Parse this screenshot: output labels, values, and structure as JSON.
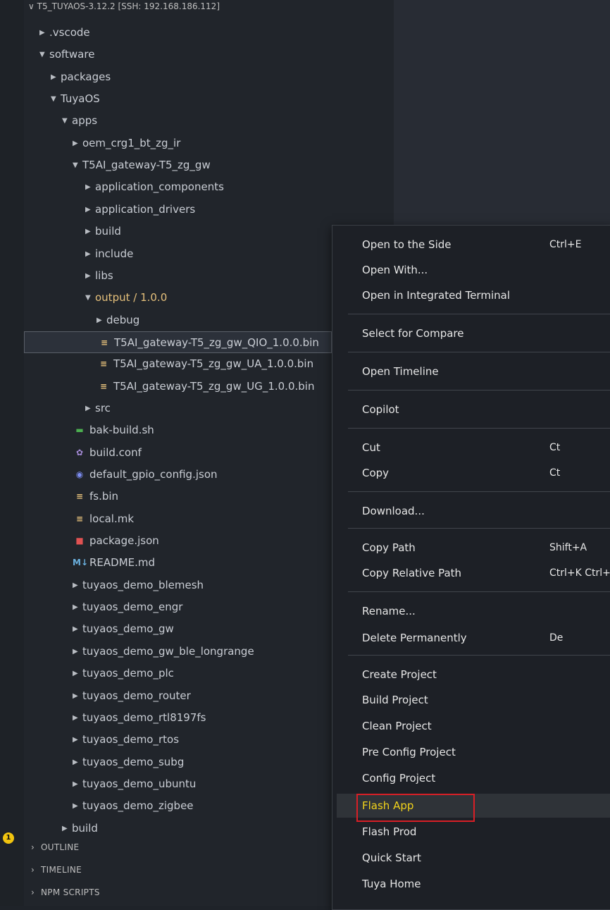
{
  "explorer": {
    "root_label": "T5_TUYAOS-3.12.2 [SSH: 192.168.186.112]",
    "tree": [
      {
        "label": ".vscode",
        "indent": 0,
        "kind": "folder",
        "open": false
      },
      {
        "label": "software",
        "indent": 0,
        "kind": "folder",
        "open": true
      },
      {
        "label": "packages",
        "indent": 1,
        "kind": "folder",
        "open": false
      },
      {
        "label": "TuyaOS",
        "indent": 1,
        "kind": "folder",
        "open": true
      },
      {
        "label": "apps",
        "indent": 2,
        "kind": "folder",
        "open": true
      },
      {
        "label": "oem_crg1_bt_zg_ir",
        "indent": 3,
        "kind": "folder",
        "open": false
      },
      {
        "label": "T5AI_gateway-T5_zg_gw",
        "indent": 3,
        "kind": "folder",
        "open": true
      },
      {
        "label": "application_components",
        "indent": 4,
        "kind": "folder",
        "open": false
      },
      {
        "label": "application_drivers",
        "indent": 4,
        "kind": "folder",
        "open": false
      },
      {
        "label": "build",
        "indent": 4,
        "kind": "folder",
        "open": false
      },
      {
        "label": "include",
        "indent": 4,
        "kind": "folder",
        "open": false
      },
      {
        "label": "libs",
        "indent": 4,
        "kind": "folder",
        "open": false
      },
      {
        "label": "output / 1.0.0",
        "indent": 4,
        "kind": "folder",
        "open": true,
        "highlight": true
      },
      {
        "label": "debug",
        "indent": 5,
        "kind": "folder",
        "open": false
      },
      {
        "label": "T5AI_gateway-T5_zg_gw_QIO_1.0.0.bin",
        "indent": 5,
        "kind": "file",
        "icon": "≡",
        "icon_color": "#e5c07b",
        "selected": true
      },
      {
        "label": "T5AI_gateway-T5_zg_gw_UA_1.0.0.bin",
        "indent": 5,
        "kind": "file",
        "icon": "≡",
        "icon_color": "#e5c07b"
      },
      {
        "label": "T5AI_gateway-T5_zg_gw_UG_1.0.0.bin",
        "indent": 5,
        "kind": "file",
        "icon": "≡",
        "icon_color": "#e5c07b"
      },
      {
        "label": "src",
        "indent": 4,
        "kind": "folder",
        "open": false
      },
      {
        "label": "bak-build.sh",
        "indent": 3,
        "kind": "file",
        "icon": "▬",
        "icon_color": "#4caf50"
      },
      {
        "label": "build.conf",
        "indent": 3,
        "kind": "file",
        "icon": "✿",
        "icon_color": "#a48ad6"
      },
      {
        "label": "default_gpio_config.json",
        "indent": 3,
        "kind": "file",
        "icon": "◉",
        "icon_color": "#7c8cf0"
      },
      {
        "label": "fs.bin",
        "indent": 3,
        "kind": "file",
        "icon": "≡",
        "icon_color": "#e5c07b"
      },
      {
        "label": "local.mk",
        "indent": 3,
        "kind": "file",
        "icon": "≡",
        "icon_color": "#e5c07b"
      },
      {
        "label": "package.json",
        "indent": 3,
        "kind": "file",
        "icon": "■",
        "icon_color": "#e05252"
      },
      {
        "label": "README.md",
        "indent": 3,
        "kind": "file",
        "icon": "M↓",
        "icon_color": "#6ab0de"
      },
      {
        "label": "tuyaos_demo_blemesh",
        "indent": 3,
        "kind": "folder",
        "open": false
      },
      {
        "label": "tuyaos_demo_engr",
        "indent": 3,
        "kind": "folder",
        "open": false
      },
      {
        "label": "tuyaos_demo_gw",
        "indent": 3,
        "kind": "folder",
        "open": false
      },
      {
        "label": "tuyaos_demo_gw_ble_longrange",
        "indent": 3,
        "kind": "folder",
        "open": false
      },
      {
        "label": "tuyaos_demo_plc",
        "indent": 3,
        "kind": "folder",
        "open": false
      },
      {
        "label": "tuyaos_demo_router",
        "indent": 3,
        "kind": "folder",
        "open": false
      },
      {
        "label": "tuyaos_demo_rtl8197fs",
        "indent": 3,
        "kind": "folder",
        "open": false
      },
      {
        "label": "tuyaos_demo_rtos",
        "indent": 3,
        "kind": "folder",
        "open": false
      },
      {
        "label": "tuyaos_demo_subg",
        "indent": 3,
        "kind": "folder",
        "open": false
      },
      {
        "label": "tuyaos_demo_ubuntu",
        "indent": 3,
        "kind": "folder",
        "open": false
      },
      {
        "label": "tuyaos_demo_zigbee",
        "indent": 3,
        "kind": "folder",
        "open": false
      },
      {
        "label": "build",
        "indent": 2,
        "kind": "folder",
        "open": false
      }
    ]
  },
  "sections": [
    "OUTLINE",
    "TIMELINE",
    "NPM SCRIPTS"
  ],
  "activity_badges": [
    "1"
  ],
  "context_menu": {
    "items": [
      {
        "label": "Open to the Side",
        "shortcut": "Ctrl+E"
      },
      {
        "label": "Open With...",
        "shortcut": ""
      },
      {
        "label": "Open in Integrated Terminal",
        "shortcut": ""
      },
      {
        "label": "Select for Compare",
        "shortcut": ""
      },
      {
        "label": "Open Timeline",
        "shortcut": ""
      },
      {
        "label": "Copilot",
        "shortcut": ""
      },
      {
        "label": "Cut",
        "shortcut": "Ct"
      },
      {
        "label": "Copy",
        "shortcut": "Ct"
      },
      {
        "label": "Download...",
        "shortcut": ""
      },
      {
        "label": "Copy Path",
        "shortcut": "Shift+A"
      },
      {
        "label": "Copy Relative Path",
        "shortcut": "Ctrl+K Ctrl+Shi"
      },
      {
        "label": "Rename...",
        "shortcut": ""
      },
      {
        "label": "Delete Permanently",
        "shortcut": "De"
      },
      {
        "label": "Create Project",
        "shortcut": ""
      },
      {
        "label": "Build Project",
        "shortcut": ""
      },
      {
        "label": "Clean Project",
        "shortcut": ""
      },
      {
        "label": "Pre Config Project",
        "shortcut": ""
      },
      {
        "label": "Config Project",
        "shortcut": ""
      },
      {
        "label": "Flash App",
        "shortcut": "",
        "highlight": true
      },
      {
        "label": "Flash Prod",
        "shortcut": ""
      },
      {
        "label": "Quick Start",
        "shortcut": ""
      },
      {
        "label": "Tuya Home",
        "shortcut": ""
      }
    ]
  },
  "colors": {
    "highlight_text": "#f2d31b",
    "annotation_box": "#d81f26",
    "folder_highlight": "#e5c07b"
  }
}
